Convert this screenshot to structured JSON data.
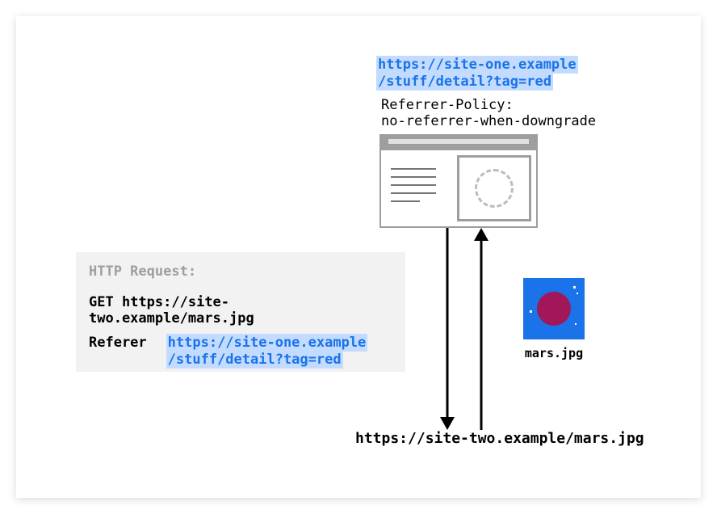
{
  "siteOne": {
    "urlLine1": "https://site-one.example",
    "urlLine2": "/stuff/detail?tag=red",
    "policyLabel": "Referrer-Policy:",
    "policyValue": "no-referrer-when-downgrade"
  },
  "httpRequest": {
    "title": "HTTP Request:",
    "method": "GET",
    "targetUrl": "https://site-two.example/mars.jpg",
    "refererLabel": "Referer",
    "refererLine1": "https://site-one.example",
    "refererLine2": "/stuff/detail?tag=red"
  },
  "image": {
    "name": "mars.jpg"
  },
  "siteTwo": {
    "url": "https://site-two.example/mars.jpg"
  }
}
